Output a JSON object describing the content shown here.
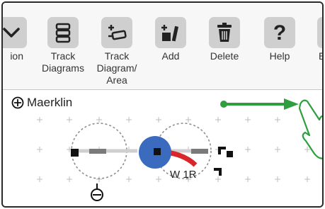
{
  "toolbar": {
    "buttons": [
      {
        "id": "collapse",
        "label": "ion",
        "icon": "chevron-down-icon"
      },
      {
        "id": "track-diagrams",
        "label_line1": "Track",
        "label_line2": "Diagrams",
        "icon": "track-diagrams-icon"
      },
      {
        "id": "track-diagram-area",
        "label_line1": "Track",
        "label_line2": "Diagram/",
        "label_line3": "Area",
        "icon": "add-track-diagram-icon"
      },
      {
        "id": "add",
        "label": "Add",
        "icon": "add-track-icon"
      },
      {
        "id": "delete",
        "label": "Delete",
        "icon": "trash-icon"
      },
      {
        "id": "help",
        "label": "Help",
        "icon": "help-icon"
      },
      {
        "id": "edit",
        "label": "E",
        "icon": "edit-icon"
      }
    ]
  },
  "canvas": {
    "title": "Maerklin",
    "switch_label": "W 1R"
  },
  "colors": {
    "toolbar_bg": "#f7f7f7",
    "icon_bg": "#cfcfcf",
    "selected_node": "#3b6bbf",
    "active_route": "#d9262b",
    "pointer": "#2e9e3e"
  }
}
